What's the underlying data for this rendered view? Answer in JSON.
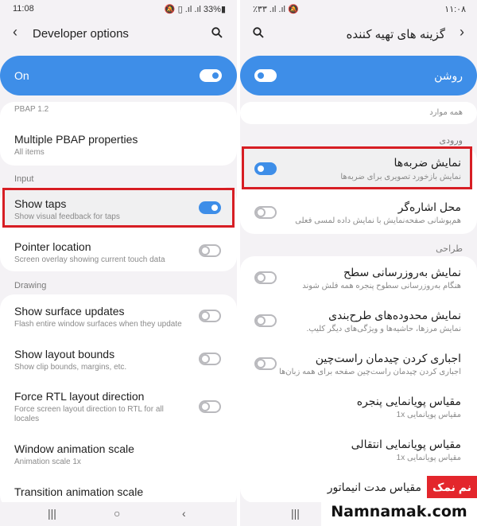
{
  "left": {
    "status": {
      "time": "11:08",
      "right": "🔕 ▯ .ıl .ıl 33%▮"
    },
    "appbar": {
      "back": "‹",
      "title": "Developer options"
    },
    "master": {
      "label": "On"
    },
    "rows": {
      "pbap_ver": "PBAP 1.2",
      "multi_pbap": {
        "title": "Multiple PBAP properties",
        "sub": "All items"
      },
      "section_input": "Input",
      "show_taps": {
        "title": "Show taps",
        "sub": "Show visual feedback for taps"
      },
      "pointer": {
        "title": "Pointer location",
        "sub": "Screen overlay showing current touch data"
      },
      "section_drawing": "Drawing",
      "surface": {
        "title": "Show surface updates",
        "sub": "Flash entire window surfaces when they update"
      },
      "layout": {
        "title": "Show layout bounds",
        "sub": "Show clip bounds, margins, etc."
      },
      "rtl": {
        "title": "Force RTL layout direction",
        "sub": "Force screen layout direction to RTL for all locales"
      },
      "window_anim": {
        "title": "Window animation scale",
        "sub": "Animation scale 1x"
      },
      "transition_anim": {
        "title": "Transition animation scale"
      }
    },
    "nav": {
      "recent": "|||",
      "home": "○",
      "back": "‹"
    }
  },
  "right": {
    "status": {
      "time": "۱۱:۰۸",
      "left": "٪۳۳ .ıl .ıl 🔕"
    },
    "appbar": {
      "back": "›",
      "title": "گزینه های تهیه کننده"
    },
    "master": {
      "label": "روشن"
    },
    "rows": {
      "all_items": "همه موارد",
      "section_input": "ورودی",
      "show_taps": {
        "title": "نمایش ضربه‌ها",
        "sub": "نمایش بازخورد تصویری برای ضربه‌ها"
      },
      "pointer": {
        "title": "محل اشاره‌گر",
        "sub": "هم‌پوشانی صفحه‌نمایش با نمایش داده لمسی فعلی"
      },
      "section_design": "طراحی",
      "surface": {
        "title": "نمایش به‌روزرسانی سطح",
        "sub": "هنگام به‌روزرسانی سطوح پنجره همه فلش شوند"
      },
      "layout": {
        "title": "نمایش محدوده‌های طرح‌بندی",
        "sub": "نمایش مرزها، حاشیه‌ها و ویژگی‌های دیگر کلیپ."
      },
      "rtl": {
        "title": "اجباری کردن چیدمان راست‌چین",
        "sub": "اجباری کردن چیدمان راست‌چین صفحه برای همه زبان‌ها"
      },
      "window_anim": {
        "title": "مقیاس پویانمایی پنجره",
        "sub": "مقیاس پویانمایی 1x"
      },
      "transition_anim": {
        "title": "مقیاس پویانمایی انتقالی",
        "sub": "مقیاس پویانمایی 1x"
      },
      "animator": {
        "title": "مقیاس مدت انیماتور"
      }
    },
    "nav": {
      "recent": "|||",
      "home": "○"
    }
  },
  "watermark": {
    "brand_fa": "نم نمک",
    "brand_en": "Namnamak.com"
  },
  "colors": {
    "accent": "#3e8ee8",
    "highlight": "#d71e24",
    "background": "#f4f2f5"
  }
}
